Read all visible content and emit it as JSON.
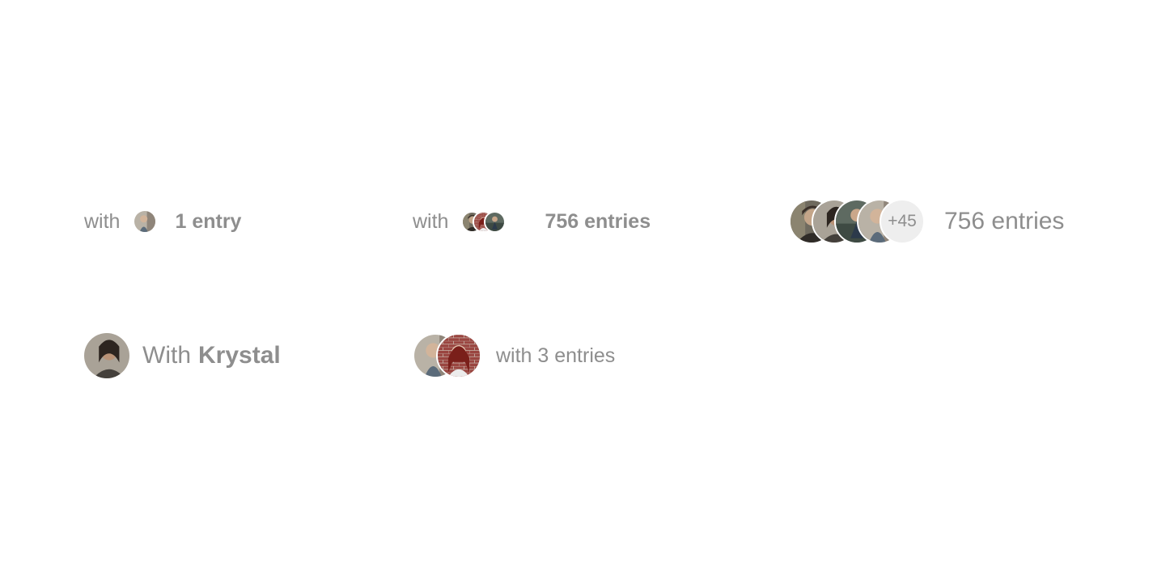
{
  "rows": [
    {
      "prefix": "with",
      "count_label": "1 entry",
      "avatars": [
        "person-avatar"
      ]
    },
    {
      "prefix": "with",
      "count_label": "756 entries",
      "avatars": [
        "person-avatar",
        "person-avatar",
        "person-avatar"
      ]
    },
    {
      "overflow_label": "+45",
      "count_label": "756 entries",
      "avatars": [
        "person-avatar",
        "person-avatar",
        "person-avatar",
        "person-avatar"
      ]
    },
    {
      "prefix": "With",
      "name": "Krystal",
      "avatars": [
        "person-avatar"
      ]
    },
    {
      "label": "with 3 entries",
      "avatars": [
        "person-avatar",
        "person-avatar"
      ]
    }
  ],
  "colors": {
    "text": "#8e8e8e",
    "overflow_bg": "#eeeeee",
    "avatar_ring": "#ffffff"
  }
}
